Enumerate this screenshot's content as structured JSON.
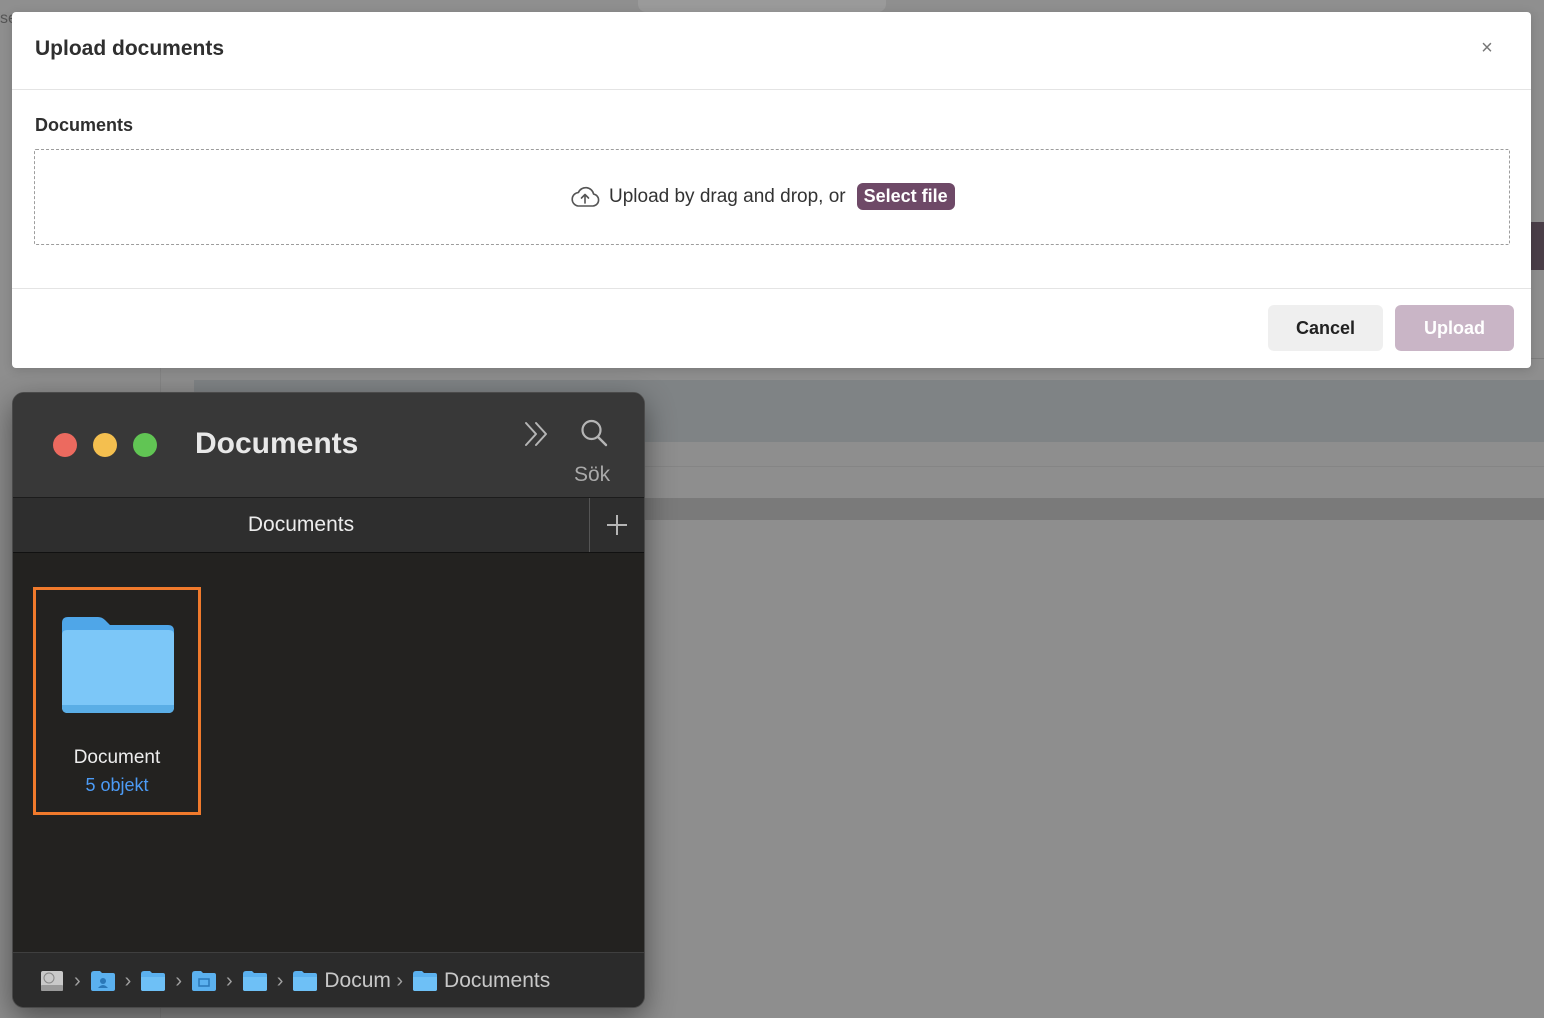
{
  "modal": {
    "title": "Upload documents",
    "close_glyph": "×",
    "field_label": "Documents",
    "dropzone_text": "Upload by drag and drop, or",
    "select_file_label": "Select file",
    "cancel_label": "Cancel",
    "upload_label": "Upload"
  },
  "background": {
    "partial_text": "se"
  },
  "finder": {
    "title": "Documents",
    "search_label": "Sök",
    "tab_label": "Documents",
    "items": [
      {
        "name": "Document",
        "count": "5 objekt",
        "selected": true
      }
    ],
    "path": [
      {
        "icon": "hard-drive-icon",
        "label": ""
      },
      {
        "icon": "home-folder-icon",
        "label": ""
      },
      {
        "icon": "folder-icon",
        "label": ""
      },
      {
        "icon": "desktop-folder-icon",
        "label": ""
      },
      {
        "icon": "folder-icon",
        "label": ""
      },
      {
        "icon": "folder-icon",
        "label": "Docum"
      },
      {
        "icon": "folder-icon",
        "label": "Documents"
      }
    ]
  },
  "colors": {
    "accent": "#6e4967",
    "upload_disabled": "#c9b5c6",
    "selection": "#f07a2c",
    "folder": "#6cb8f0",
    "count_text": "#4c9bf5"
  }
}
